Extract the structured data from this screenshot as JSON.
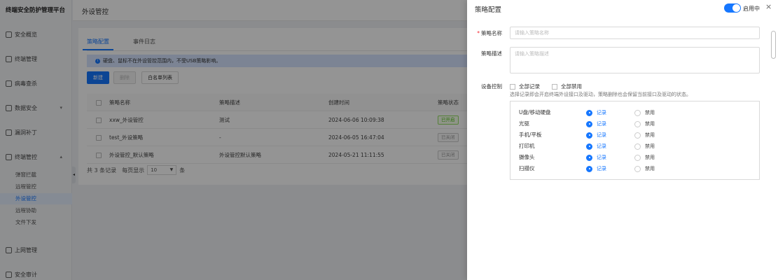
{
  "app_title": "终端安全防护管理平台",
  "page_title": "外设管控",
  "sidebar": {
    "items": [
      {
        "label": "安全概览",
        "icon": "dashboard-icon"
      },
      {
        "label": "终端管理",
        "icon": "terminal-icon"
      },
      {
        "label": "病毒查杀",
        "icon": "virus-icon"
      },
      {
        "label": "数据安全",
        "icon": "data-security-icon",
        "expandable": true
      },
      {
        "label": "漏洞补丁",
        "icon": "patch-icon"
      },
      {
        "label": "终端管控",
        "icon": "control-icon",
        "expanded": true
      },
      {
        "label": "上网管理",
        "icon": "internet-icon"
      },
      {
        "label": "安全审计",
        "icon": "audit-icon"
      }
    ],
    "submenu": [
      {
        "label": "弹窗拦截"
      },
      {
        "label": "远程管控"
      },
      {
        "label": "外设管控",
        "active": true
      },
      {
        "label": "远程协助"
      },
      {
        "label": "文件下发"
      }
    ]
  },
  "tabs": [
    {
      "label": "策略配置",
      "active": true
    },
    {
      "label": "事件日志"
    }
  ],
  "alert_text": "硬盘、鼠标不在外设管控范围内，不受USB策略影响。",
  "toolbar": {
    "new": "新建",
    "delete": "删除",
    "whitelist": "白名单列表"
  },
  "table": {
    "headers": [
      "策略名称",
      "策略描述",
      "创建时间",
      "策略状态"
    ],
    "rows": [
      {
        "name": "xxw_外设管控",
        "desc": "测试",
        "time": "2024-06-06 10:09:38",
        "status": "已开启",
        "on": true
      },
      {
        "name": "test_外设策略",
        "desc": "-",
        "time": "2024-06-05 16:47:04",
        "status": "已关闭",
        "on": false
      },
      {
        "name": "外设管控_默认策略",
        "desc": "外设管控默认策略",
        "time": "2024-05-21 11:11:55",
        "status": "已关闭",
        "on": false
      }
    ]
  },
  "pager": {
    "total": "共 3 条记录",
    "per_page_label": "每页显示",
    "page_size": "10",
    "unit": "条"
  },
  "drawer": {
    "title": "策略配置",
    "switch_label": "启用中",
    "close": "×",
    "name_label": "策略名称",
    "name_placeholder": "请输入策略名称",
    "desc_label": "策略描述",
    "desc_placeholder": "请输入策略描述",
    "device_label": "设备控制",
    "all_record": "全部记录",
    "all_disable": "全部禁用",
    "hint": "选择记录即会开启终端外设接口及驱动，策略删除也会保留当前接口及驱动的状态。",
    "record_label": "记录",
    "disable_label": "禁用",
    "devices": [
      {
        "name": "U盘/移动硬盘",
        "mode": "record"
      },
      {
        "name": "光驱",
        "mode": "record"
      },
      {
        "name": "手机/平板",
        "mode": "record"
      },
      {
        "name": "打印机",
        "mode": "record"
      },
      {
        "name": "摄像头",
        "mode": "record"
      },
      {
        "name": "扫描仪",
        "mode": "record"
      }
    ]
  },
  "colors": {
    "accent": "#1677ff",
    "success": "#52c41a",
    "required": "#f5222d"
  }
}
